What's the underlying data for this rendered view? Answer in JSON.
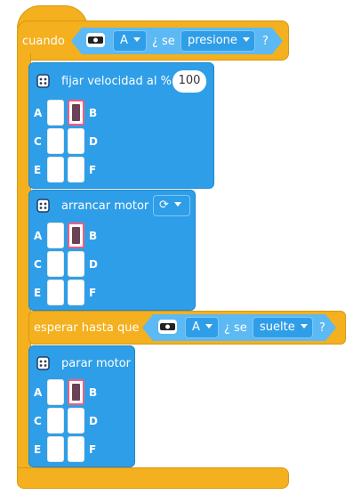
{
  "event": {
    "when_label": "cuando",
    "port": "A",
    "se_label": "¿ se",
    "state": "presione",
    "question": "?"
  },
  "set_speed": {
    "label": "fijar velocidad al %",
    "value": "100"
  },
  "start_motor": {
    "label": "arrancar motor"
  },
  "wait": {
    "label": "esperar hasta que",
    "port": "A",
    "se_label": "¿ se",
    "state": "suelte",
    "question": "?"
  },
  "stop_motor": {
    "label": "parar motor"
  },
  "ports": {
    "a": "A",
    "b": "B",
    "c": "C",
    "d": "D",
    "e": "E",
    "f": "F"
  },
  "icons": {
    "hub": "hub-icon",
    "sensor": "force-sensor-icon",
    "direction": "clockwise-icon",
    "dropdown": "caret-down-icon"
  },
  "colors": {
    "event_yellow": "#f4b01e",
    "motor_blue": "#2f9ee8",
    "sensor_blue": "#5cb9f3",
    "selected_port": "#ff5c7a"
  }
}
